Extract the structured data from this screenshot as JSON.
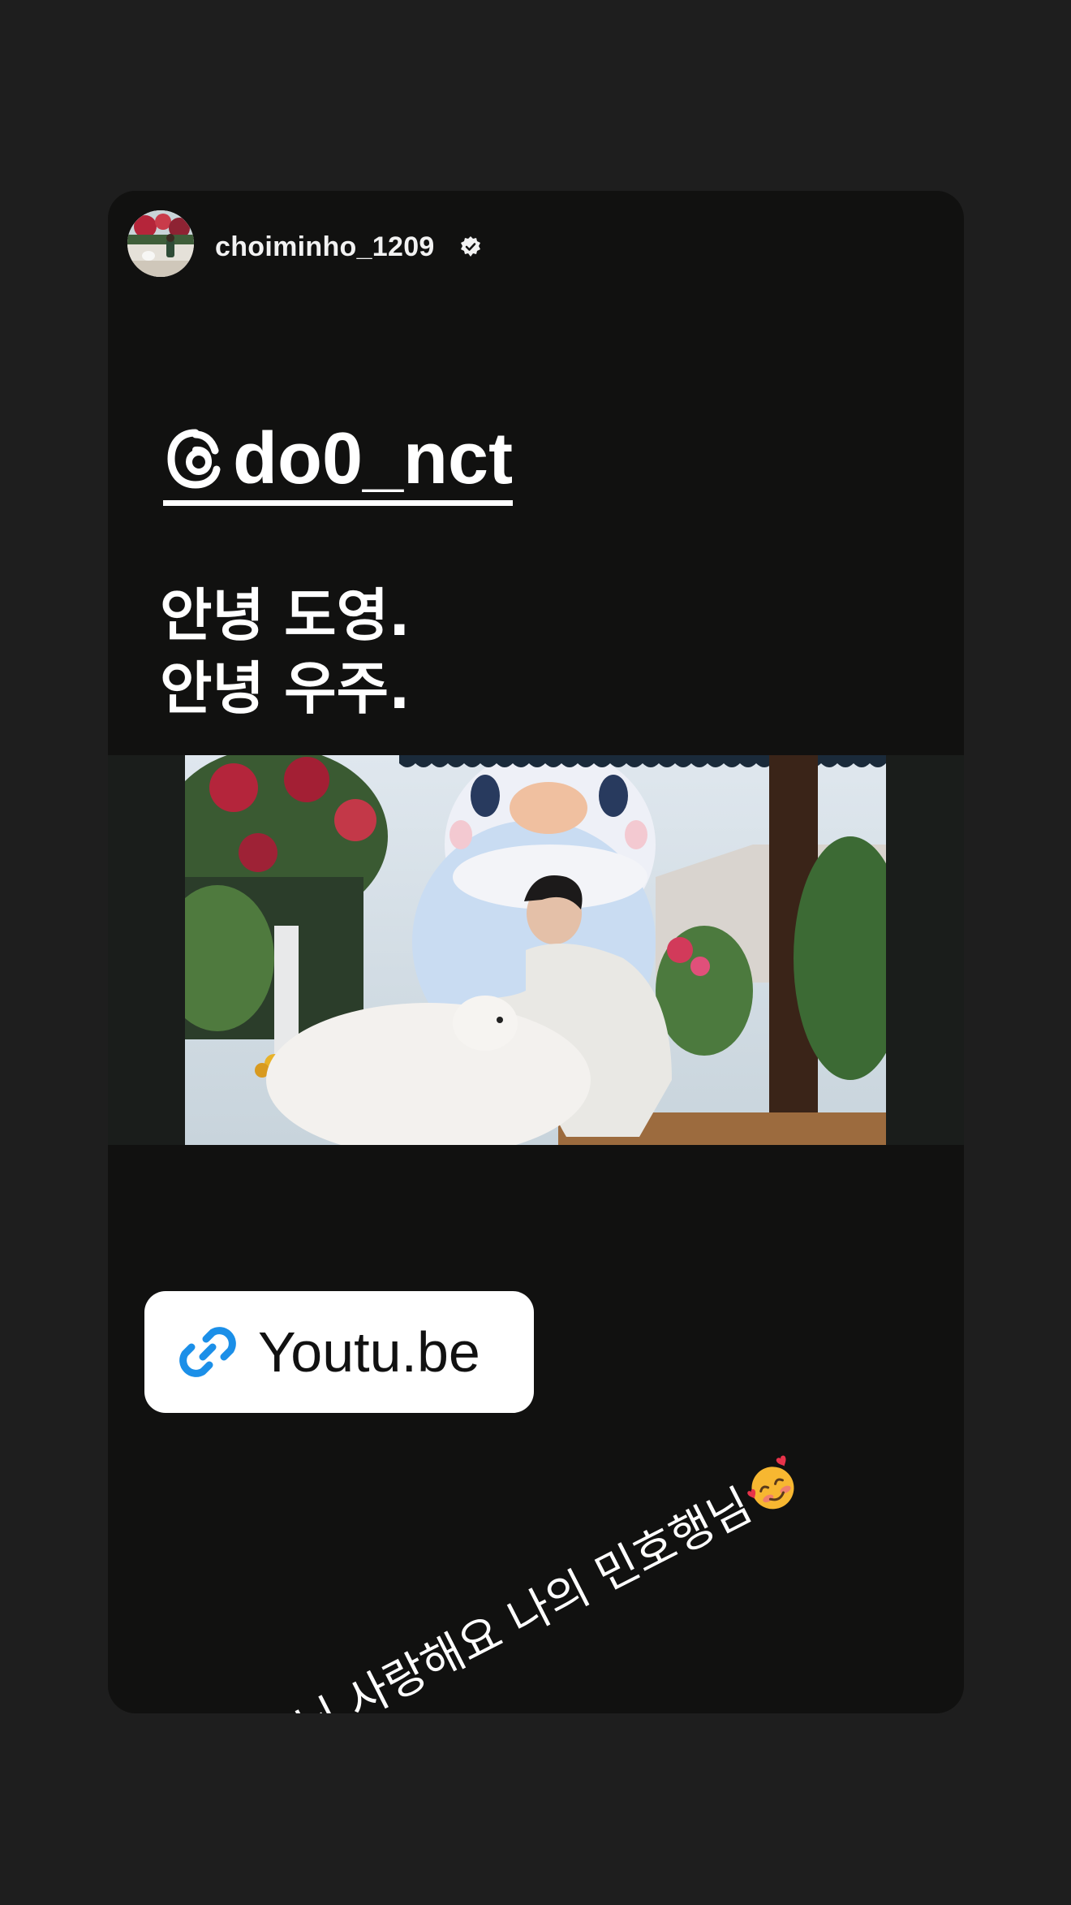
{
  "story": {
    "username": "choiminho_1209",
    "verified_icon": "verified-badge-icon",
    "mention": "do0_nct",
    "mention_icon": "threads-logo-icon",
    "greeting_line1": "안녕 도영.",
    "greeting_line2": "안녕 우주.",
    "media_description_icon": "video-thumbnail",
    "link_sticker": {
      "label": "Youtu.be",
      "icon": "link-icon",
      "accent": "#1b8fe8"
    },
    "caption": "행님 사랑해요 나의 민호행님",
    "caption_emoji": "smiling-face-with-hearts-icon"
  },
  "colors": {
    "background": "#1e1e1e",
    "card": "#111110",
    "text": "#ffffff"
  }
}
